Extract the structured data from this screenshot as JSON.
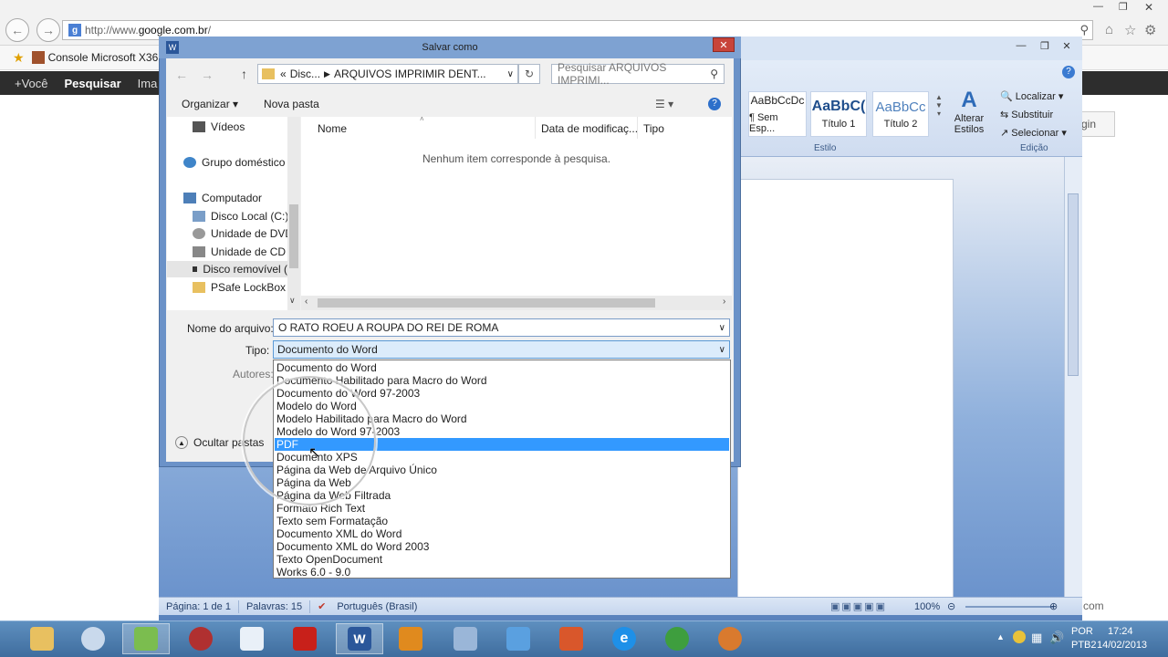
{
  "browser": {
    "url_prefix": "http://www.",
    "url_domain": "google.com.br",
    "url_suffix": "/",
    "favorite_item": "Console Microsoft X36",
    "google_bar": [
      "+Você",
      "Pesquisar",
      "Ima"
    ],
    "login_partial": "gin",
    "footer_partial": "com"
  },
  "word": {
    "ribbon": {
      "styles": [
        {
          "preview": "AaBbCcDc",
          "label": "¶ Sem Esp..."
        },
        {
          "preview": "AaBbC(",
          "label": "Título 1"
        },
        {
          "preview": "AaBbCc",
          "label": "Título 2"
        }
      ],
      "change_styles": "Alterar Estilos",
      "style_group": "Estilo",
      "edit_items": [
        "Localizar",
        "Substituir",
        "Selecionar"
      ],
      "edit_group": "Edição"
    },
    "status": {
      "page": "Página: 1 de 1",
      "words": "Palavras: 15",
      "language": "Português (Brasil)",
      "zoom": "100%"
    }
  },
  "dialog": {
    "title": "Salvar como",
    "close": "✕",
    "path": [
      "«",
      "Disc...",
      "ARQUIVOS IMPRIMIR DENT..."
    ],
    "search_placeholder": "Pesquisar ARQUIVOS IMPRIMI...",
    "organize": "Organizar",
    "new_folder": "Nova pasta",
    "nav_items": [
      {
        "label": "Vídeos",
        "icon": "video-icon"
      },
      {
        "label": "Grupo doméstico",
        "icon": "homegroup-icon"
      },
      {
        "label": "Computador",
        "icon": "computer-icon"
      },
      {
        "label": "Disco Local (C:)",
        "icon": "drive-icon"
      },
      {
        "label": "Unidade de DVD-",
        "icon": "dvd-icon"
      },
      {
        "label": "Unidade de CD (E",
        "icon": "cd-icon"
      },
      {
        "label": "Disco removível (",
        "icon": "removable-drive-icon"
      },
      {
        "label": "PSafe LockBox",
        "icon": "folder-icon"
      }
    ],
    "columns": [
      "Nome",
      "Data de modificaç...",
      "Tipo"
    ],
    "empty_message": "Nenhum item corresponde à pesquisa.",
    "filename_label": "Nome do arquivo:",
    "filename_value": "O RATO ROEU  A ROUPA DO REI DE ROMA",
    "type_label": "Tipo:",
    "type_value": "Documento do Word",
    "authors_label": "Autores:",
    "hide_folders": "Ocultar pastas",
    "type_options": [
      "Documento do Word",
      "Documento Habilitado para Macro do Word",
      "Documento do Word 97-2003",
      "Modelo do Word",
      "Modelo Habilitado para Macro do Word",
      "Modelo do Word 97-2003",
      "PDF",
      "Documento XPS",
      "Página da Web de Arquivo Único",
      "Página da Web",
      "Página da Web Filtrada",
      "Formato Rich Text",
      "Texto sem Formatação",
      "Documento XML do Word",
      "Documento XML do Word 2003",
      "Texto OpenDocument",
      "Works 6.0 - 9.0"
    ],
    "selected_option": "PDF"
  },
  "taskbar": {
    "lang_top": "POR",
    "lang_bottom": "PTB2",
    "time": "17:24",
    "date": "14/02/2013"
  },
  "colors": {
    "selection": "#3399ff",
    "word_blue": "#5a83bd",
    "close_red": "#c8443a"
  }
}
